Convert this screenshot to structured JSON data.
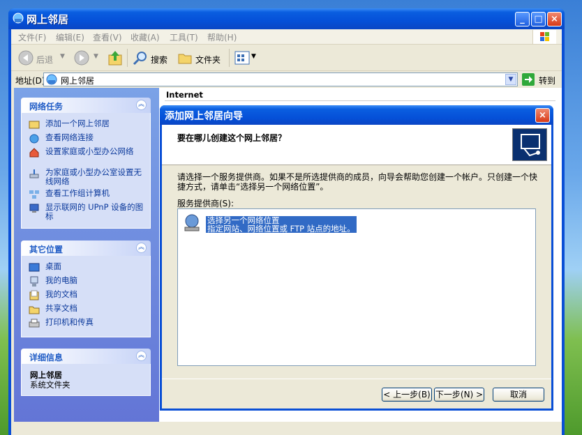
{
  "window": {
    "title": "网上邻居"
  },
  "menu": [
    "文件(F)",
    "编辑(E)",
    "查看(V)",
    "收藏(A)",
    "工具(T)",
    "帮助(H)"
  ],
  "toolbar": {
    "back": "后退",
    "search": "搜索",
    "folders": "文件夹"
  },
  "address": {
    "label": "地址(D)",
    "value": "网上邻居",
    "go": "转到"
  },
  "tasks": {
    "title": "网络任务",
    "items": [
      "添加一个网上邻居",
      "查看网络连接",
      "设置家庭或小型办公网络",
      "为家庭或小型办公室设置无线网络",
      "查看工作组计算机",
      "显示联网的 UPnP 设备的图标"
    ]
  },
  "other": {
    "title": "其它位置",
    "items": [
      "桌面",
      "我的电脑",
      "我的文档",
      "共享文档",
      "打印机和传真"
    ]
  },
  "details": {
    "title": "详细信息",
    "name": "网上邻居",
    "type": "系统文件夹"
  },
  "content": {
    "column": "Internet"
  },
  "dialog": {
    "title": "添加网上邻居向导",
    "heading": "要在哪儿创建这个网上邻居？",
    "desc": "请选择一个服务提供商。如果不是所选提供商的成员，向导会帮助您创建一个帐户。只创建一个快捷方式，请单击“选择另一个网络位置”。",
    "list_label": "服务提供商(S):",
    "option_title": "选择另一个网络位置",
    "option_desc": "指定网站、网络位置或 FTP 站点的地址。",
    "back": "< 上一步(B)",
    "next": "下一步(N) >",
    "cancel": "取消"
  },
  "colors": {
    "title_blue": "#0550d8",
    "panel_blue": "#6375d6",
    "link": "#0c3a9c",
    "select": "#316ac5"
  }
}
